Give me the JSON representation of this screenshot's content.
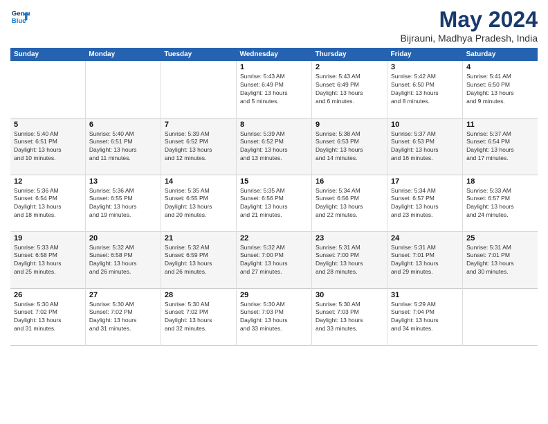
{
  "logo": {
    "line1": "General",
    "line2": "Blue"
  },
  "title": "May 2024",
  "subtitle": "Bijrauni, Madhya Pradesh, India",
  "days_of_week": [
    "Sunday",
    "Monday",
    "Tuesday",
    "Wednesday",
    "Thursday",
    "Friday",
    "Saturday"
  ],
  "weeks": [
    [
      {
        "day": "",
        "info": ""
      },
      {
        "day": "",
        "info": ""
      },
      {
        "day": "",
        "info": ""
      },
      {
        "day": "1",
        "info": "Sunrise: 5:43 AM\nSunset: 6:49 PM\nDaylight: 13 hours\nand 5 minutes."
      },
      {
        "day": "2",
        "info": "Sunrise: 5:43 AM\nSunset: 6:49 PM\nDaylight: 13 hours\nand 6 minutes."
      },
      {
        "day": "3",
        "info": "Sunrise: 5:42 AM\nSunset: 6:50 PM\nDaylight: 13 hours\nand 8 minutes."
      },
      {
        "day": "4",
        "info": "Sunrise: 5:41 AM\nSunset: 6:50 PM\nDaylight: 13 hours\nand 9 minutes."
      }
    ],
    [
      {
        "day": "5",
        "info": "Sunrise: 5:40 AM\nSunset: 6:51 PM\nDaylight: 13 hours\nand 10 minutes."
      },
      {
        "day": "6",
        "info": "Sunrise: 5:40 AM\nSunset: 6:51 PM\nDaylight: 13 hours\nand 11 minutes."
      },
      {
        "day": "7",
        "info": "Sunrise: 5:39 AM\nSunset: 6:52 PM\nDaylight: 13 hours\nand 12 minutes."
      },
      {
        "day": "8",
        "info": "Sunrise: 5:39 AM\nSunset: 6:52 PM\nDaylight: 13 hours\nand 13 minutes."
      },
      {
        "day": "9",
        "info": "Sunrise: 5:38 AM\nSunset: 6:53 PM\nDaylight: 13 hours\nand 14 minutes."
      },
      {
        "day": "10",
        "info": "Sunrise: 5:37 AM\nSunset: 6:53 PM\nDaylight: 13 hours\nand 16 minutes."
      },
      {
        "day": "11",
        "info": "Sunrise: 5:37 AM\nSunset: 6:54 PM\nDaylight: 13 hours\nand 17 minutes."
      }
    ],
    [
      {
        "day": "12",
        "info": "Sunrise: 5:36 AM\nSunset: 6:54 PM\nDaylight: 13 hours\nand 18 minutes."
      },
      {
        "day": "13",
        "info": "Sunrise: 5:36 AM\nSunset: 6:55 PM\nDaylight: 13 hours\nand 19 minutes."
      },
      {
        "day": "14",
        "info": "Sunrise: 5:35 AM\nSunset: 6:55 PM\nDaylight: 13 hours\nand 20 minutes."
      },
      {
        "day": "15",
        "info": "Sunrise: 5:35 AM\nSunset: 6:56 PM\nDaylight: 13 hours\nand 21 minutes."
      },
      {
        "day": "16",
        "info": "Sunrise: 5:34 AM\nSunset: 6:56 PM\nDaylight: 13 hours\nand 22 minutes."
      },
      {
        "day": "17",
        "info": "Sunrise: 5:34 AM\nSunset: 6:57 PM\nDaylight: 13 hours\nand 23 minutes."
      },
      {
        "day": "18",
        "info": "Sunrise: 5:33 AM\nSunset: 6:57 PM\nDaylight: 13 hours\nand 24 minutes."
      }
    ],
    [
      {
        "day": "19",
        "info": "Sunrise: 5:33 AM\nSunset: 6:58 PM\nDaylight: 13 hours\nand 25 minutes."
      },
      {
        "day": "20",
        "info": "Sunrise: 5:32 AM\nSunset: 6:58 PM\nDaylight: 13 hours\nand 26 minutes."
      },
      {
        "day": "21",
        "info": "Sunrise: 5:32 AM\nSunset: 6:59 PM\nDaylight: 13 hours\nand 26 minutes."
      },
      {
        "day": "22",
        "info": "Sunrise: 5:32 AM\nSunset: 7:00 PM\nDaylight: 13 hours\nand 27 minutes."
      },
      {
        "day": "23",
        "info": "Sunrise: 5:31 AM\nSunset: 7:00 PM\nDaylight: 13 hours\nand 28 minutes."
      },
      {
        "day": "24",
        "info": "Sunrise: 5:31 AM\nSunset: 7:01 PM\nDaylight: 13 hours\nand 29 minutes."
      },
      {
        "day": "25",
        "info": "Sunrise: 5:31 AM\nSunset: 7:01 PM\nDaylight: 13 hours\nand 30 minutes."
      }
    ],
    [
      {
        "day": "26",
        "info": "Sunrise: 5:30 AM\nSunset: 7:02 PM\nDaylight: 13 hours\nand 31 minutes."
      },
      {
        "day": "27",
        "info": "Sunrise: 5:30 AM\nSunset: 7:02 PM\nDaylight: 13 hours\nand 31 minutes."
      },
      {
        "day": "28",
        "info": "Sunrise: 5:30 AM\nSunset: 7:02 PM\nDaylight: 13 hours\nand 32 minutes."
      },
      {
        "day": "29",
        "info": "Sunrise: 5:30 AM\nSunset: 7:03 PM\nDaylight: 13 hours\nand 33 minutes."
      },
      {
        "day": "30",
        "info": "Sunrise: 5:30 AM\nSunset: 7:03 PM\nDaylight: 13 hours\nand 33 minutes."
      },
      {
        "day": "31",
        "info": "Sunrise: 5:29 AM\nSunset: 7:04 PM\nDaylight: 13 hours\nand 34 minutes."
      },
      {
        "day": "",
        "info": ""
      }
    ]
  ]
}
